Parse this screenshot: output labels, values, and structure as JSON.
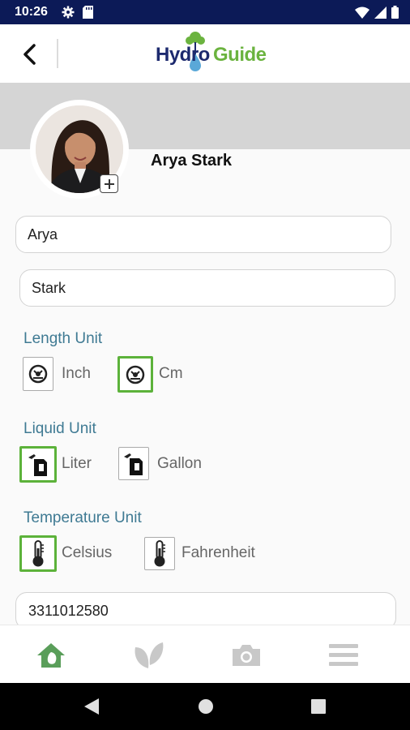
{
  "status_bar": {
    "time": "10:26",
    "icons": [
      "gear-icon",
      "sd-card-icon",
      "wifi-icon",
      "signal-icon",
      "battery-icon"
    ]
  },
  "header": {
    "logo_part1": "Hydro",
    "logo_part2": "Guide",
    "back_icon": "chevron-left-icon"
  },
  "profile": {
    "name": "Arya Stark",
    "add_photo_icon": "plus-icon"
  },
  "form": {
    "first_name": "Arya",
    "last_name": "Stark",
    "phone": "3311012580"
  },
  "length_unit": {
    "title": "Length Unit",
    "options": [
      {
        "label": "Inch",
        "selected": false,
        "icon": "tape-measure-icon"
      },
      {
        "label": "Cm",
        "selected": true,
        "icon": "tape-measure-icon"
      }
    ]
  },
  "liquid_unit": {
    "title": "Liquid Unit",
    "options": [
      {
        "label": "Liter",
        "selected": true,
        "icon": "fuel-can-icon"
      },
      {
        "label": "Gallon",
        "selected": false,
        "icon": "fuel-can-icon"
      }
    ]
  },
  "temperature_unit": {
    "title": "Temperature Unit",
    "options": [
      {
        "label": "Celsius",
        "selected": true,
        "icon": "thermometer-icon"
      },
      {
        "label": "Fahrenheit",
        "selected": false,
        "icon": "thermometer-icon"
      }
    ]
  },
  "bottom_nav": {
    "items": [
      "home-icon",
      "leaves-icon",
      "camera-icon",
      "menu-icon"
    ],
    "active": "home-icon",
    "active_color": "#5a9e5a",
    "inactive_color": "#c8c8c8"
  },
  "colors": {
    "status_bar": "#0c1a57",
    "accent_green": "#5cb23a",
    "section_title": "#3f7a93",
    "logo_blue": "#1d2a6e",
    "logo_green": "#6bb33f"
  }
}
